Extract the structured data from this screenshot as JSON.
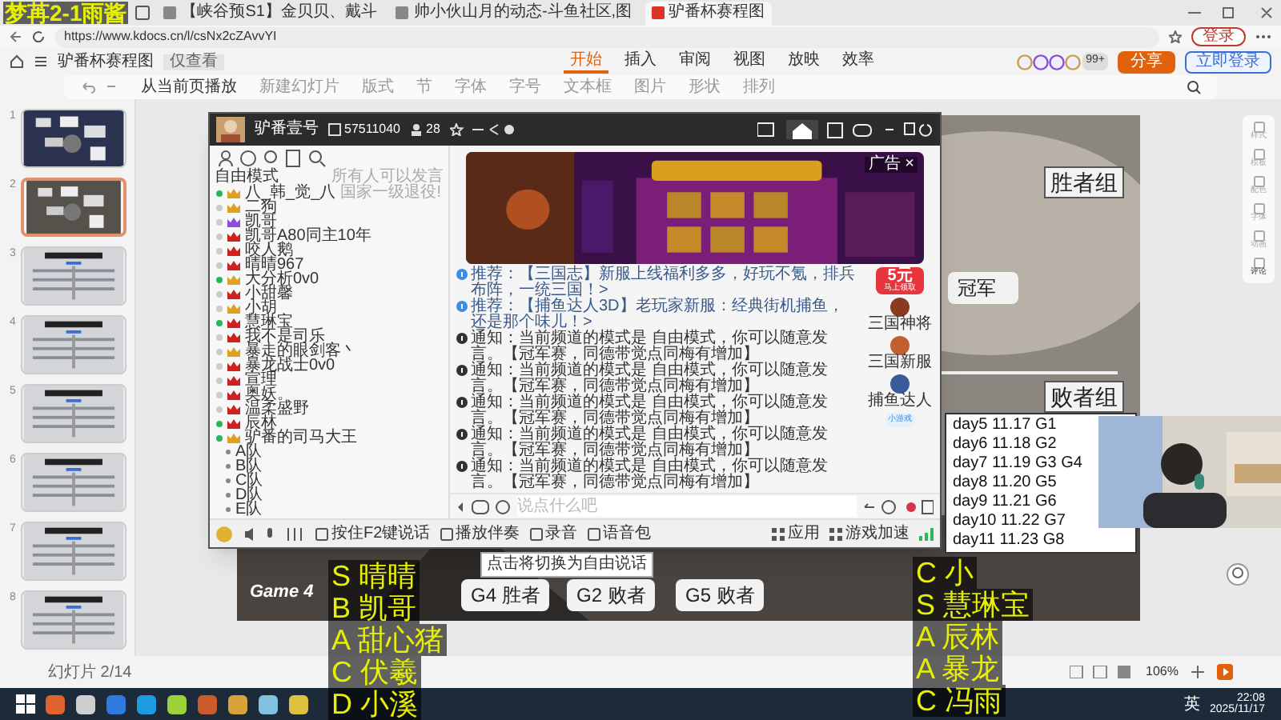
{
  "overlay_caption": "梦苒2-1雨酱",
  "browser": {
    "tabs": [
      {
        "title": "【峡谷预S1】金贝贝、戴斗",
        "selected": false
      },
      {
        "title": "帅小伙山月的动态-斗鱼社区,图",
        "selected": false
      },
      {
        "title": "驴番杯赛程图",
        "selected": true
      }
    ],
    "url": "https://www.kdocs.cn/l/csNx2cZAvvYI",
    "login": "登录"
  },
  "doc": {
    "title": "驴番杯赛程图",
    "mode": "仅查看",
    "menu": [
      {
        "label": "开始",
        "selected": true
      },
      {
        "label": "插入",
        "selected": false
      },
      {
        "label": "审阅",
        "selected": false
      },
      {
        "label": "视图",
        "selected": false
      },
      {
        "label": "放映",
        "selected": false
      },
      {
        "label": "效率",
        "selected": false
      }
    ],
    "viewers": "99+",
    "share": "分享",
    "signin": "立即登录"
  },
  "toolbar": [
    "从当前页播放",
    "新建幻灯片",
    "版式",
    "节",
    "字体",
    "字号",
    "文本框",
    "图片",
    "形状",
    "排列"
  ],
  "slides": [
    {
      "number": "1",
      "selected": false
    },
    {
      "number": "2",
      "selected": true
    },
    {
      "number": "3",
      "selected": false
    },
    {
      "number": "4",
      "selected": false
    },
    {
      "number": "5",
      "selected": false
    },
    {
      "number": "6",
      "selected": false
    },
    {
      "number": "7",
      "selected": false
    },
    {
      "number": "8",
      "selected": false
    }
  ],
  "side_panel": [
    "样式",
    "模板",
    "配色",
    "字体",
    "动画",
    "评论"
  ],
  "slide": {
    "labels": [
      {
        "text": "胜者组",
        "kind": "group"
      },
      {
        "text": "冠军",
        "kind": "final"
      },
      {
        "text": "败者组",
        "kind": "group2"
      },
      {
        "text": "Game 4",
        "kind": "game"
      },
      {
        "text": "G4 胜者",
        "kind": "g4"
      },
      {
        "text": "G2 败者",
        "kind": "g2"
      },
      {
        "text": "G5 败者",
        "kind": "g5"
      }
    ],
    "schedule": [
      "day5 11.17 G1",
      "day6 11.18 G2",
      "day7 11.19 G3 G4",
      "day8 11.20 G5",
      "day9 11.21 G6",
      "day10 11.22 G7",
      "day11 11.23 G8"
    ]
  },
  "status": {
    "slide_count": "幻灯片 2/14",
    "zoom": "106%"
  },
  "stream": {
    "room": "驴番壹号",
    "room_id": "57511040",
    "viewers": "28",
    "mode": "自由模式",
    "mode_note": "所有人可以发言",
    "users": [
      {
        "name": "八_韩_觉_八",
        "online": true,
        "color": "#e0a020",
        "note": "国家一级退役!"
      },
      {
        "name": "二狗",
        "online": false,
        "color": "#e0a020"
      },
      {
        "name": "凯哥",
        "online": false,
        "color": "#8a4fd8"
      },
      {
        "name": "凯哥A80同主10年",
        "online": false,
        "color": "#d02020"
      },
      {
        "name": "咬人鹅",
        "online": false,
        "color": "#d02020"
      },
      {
        "name": "晴晴967",
        "online": false,
        "color": "#d02020"
      },
      {
        "name": "大分析0v0",
        "online": true,
        "color": "#e0a020"
      },
      {
        "name": "小甜馨",
        "online": false,
        "color": "#d02020"
      },
      {
        "name": "小胡",
        "online": false,
        "color": "#e0a020"
      },
      {
        "name": "慧琳宝",
        "online": true,
        "color": "#d02020"
      },
      {
        "name": "我不是司乐",
        "online": false,
        "color": "#d02020"
      },
      {
        "name": "暴走的眼剑客丶",
        "online": false,
        "color": "#e0a020"
      },
      {
        "name": "暴龙战士0v0",
        "online": false,
        "color": "#d02020"
      },
      {
        "name": "宣理",
        "online": false,
        "color": "#d02020"
      },
      {
        "name": "奥妖。",
        "online": false,
        "color": "#d02020"
      },
      {
        "name": "温柔盛野",
        "online": false,
        "color": "#d02020"
      },
      {
        "name": "辰林",
        "online": true,
        "color": "#d02020"
      },
      {
        "name": "驴番的司马大王",
        "online": true,
        "color": "#e0a020"
      }
    ],
    "teams": [
      "A队",
      "B队",
      "C队",
      "D队",
      "E队"
    ],
    "ad_label": "广告 ×",
    "messages": [
      {
        "kind": "recommend",
        "text": "推荐：【三国志】新服上线福利多多，好玩不氪，排兵布阵，一统三国！>"
      },
      {
        "kind": "recommend",
        "text": "推荐：【捕鱼达人3D】老玩家新服：经典街机捕鱼，还是那个味儿！>"
      },
      {
        "kind": "notice",
        "text": "通知：当前频道的模式是 自由模式，你可以随意发言。【冠军赛，同德带觉点同梅有增加】"
      },
      {
        "kind": "notice",
        "text": "通知：当前频道的模式是 自由模式，你可以随意发言。【冠军赛，同德带觉点同梅有增加】"
      },
      {
        "kind": "notice",
        "text": "通知：当前频道的模式是 自由模式，你可以随意发言。【冠军赛，同德带觉点同梅有增加】"
      },
      {
        "kind": "notice",
        "text": "通知：当前频道的模式是 自由模式，你可以随意发言。【冠军赛，同德带觉点同梅有增加】"
      },
      {
        "kind": "notice",
        "text": "通知：当前频道的模式是 自由模式，你可以随意发言。【冠军赛，同德带觉点同梅有增加】"
      }
    ],
    "promo": {
      "amount": "5元",
      "action": "马上领取"
    },
    "games": [
      "三国神将",
      "三国新服",
      "捕鱼达人"
    ],
    "mini_games": "小游戏",
    "input": {
      "placeholder": "说点什么吧"
    },
    "bottom_bar": [
      "按住F2键说话",
      "播放伴奏",
      "录音",
      "语音包"
    ],
    "bottom_right": [
      "应用",
      "游戏加速"
    ],
    "tooltip": "点击将切换为自由说话"
  },
  "webcam": {
    "kind": "picture"
  },
  "caption_left": [
    "S 晴晴",
    "B 凯哥",
    "A 甜心猪",
    "C 伏羲",
    "D 小溪"
  ],
  "caption_right": [
    "C 小",
    "S 慧琳宝",
    "A 辰林",
    "A 暴龙",
    "C 冯雨"
  ],
  "taskbar": {
    "language": "英",
    "time": "22:08",
    "date": "2025/11/17"
  }
}
